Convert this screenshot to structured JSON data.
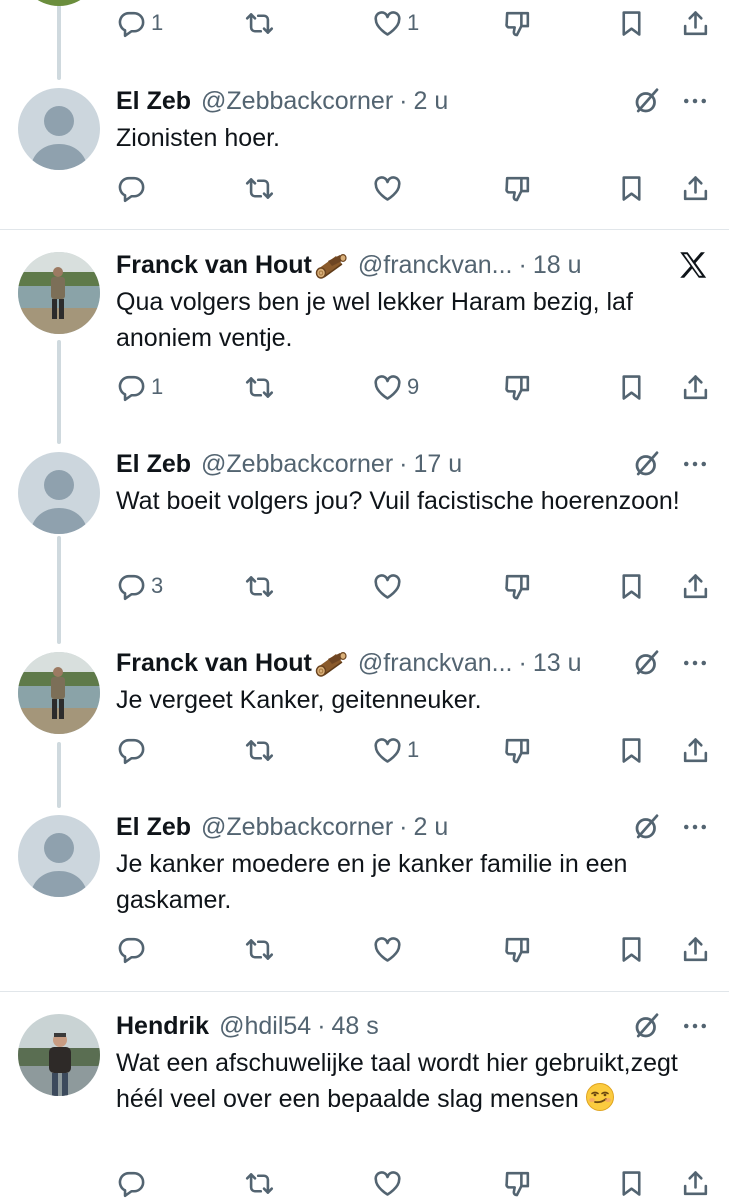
{
  "prev_actions": {
    "reply_count": "1",
    "like_count": "1"
  },
  "tweets": [
    {
      "name": "El Zeb",
      "handle": "@Zebbackcorner",
      "time": "2 u",
      "text": "Zionisten hoer.",
      "reply_count": "",
      "like_count": ""
    },
    {
      "name": "Franck van Hout",
      "handle": "@franckvan...",
      "time": "18 u",
      "text": "Qua volgers ben je wel lekker Haram bezig, laf anoniem ventje.",
      "reply_count": "1",
      "like_count": "9"
    },
    {
      "name": "El Zeb",
      "handle": "@Zebbackcorner",
      "time": "17 u",
      "text": "Wat boeit volgers jou? Vuil facistische hoerenzoon!",
      "reply_count": "3",
      "like_count": ""
    },
    {
      "name": "Franck van Hout",
      "handle": "@franckvan...",
      "time": "13 u",
      "text": "Je vergeet Kanker, geitenneuker.",
      "reply_count": "",
      "like_count": "1"
    },
    {
      "name": "El Zeb",
      "handle": "@Zebbackcorner",
      "time": "2 u",
      "text": "Je kanker moedere en je kanker familie in een gaskamer.",
      "reply_count": "",
      "like_count": ""
    },
    {
      "name": "Hendrik",
      "handle": "@hdil54",
      "time": "48 s",
      "text": "Wat een afschuwelijke taal wordt hier gebruikt,zegt héél veel over een bepaalde slag mensen",
      "reply_count": "",
      "like_count": ""
    }
  ],
  "separator": "·",
  "icons": {
    "reply": "reply-icon",
    "retweet": "retweet-icon",
    "like": "heart-icon",
    "dislike": "thumbs-down-icon",
    "bookmark": "bookmark-icon",
    "share": "share-icon",
    "grok": "grok-icon",
    "more": "more-icon",
    "x_logo": "x-logo-icon",
    "emoji": "smirking-face-emoji",
    "log": "wood-log-emoji"
  },
  "colors": {
    "text": "#0f1419",
    "secondary": "#536471",
    "thread_line": "#cfd9de",
    "divider": "#e1e6ea"
  }
}
